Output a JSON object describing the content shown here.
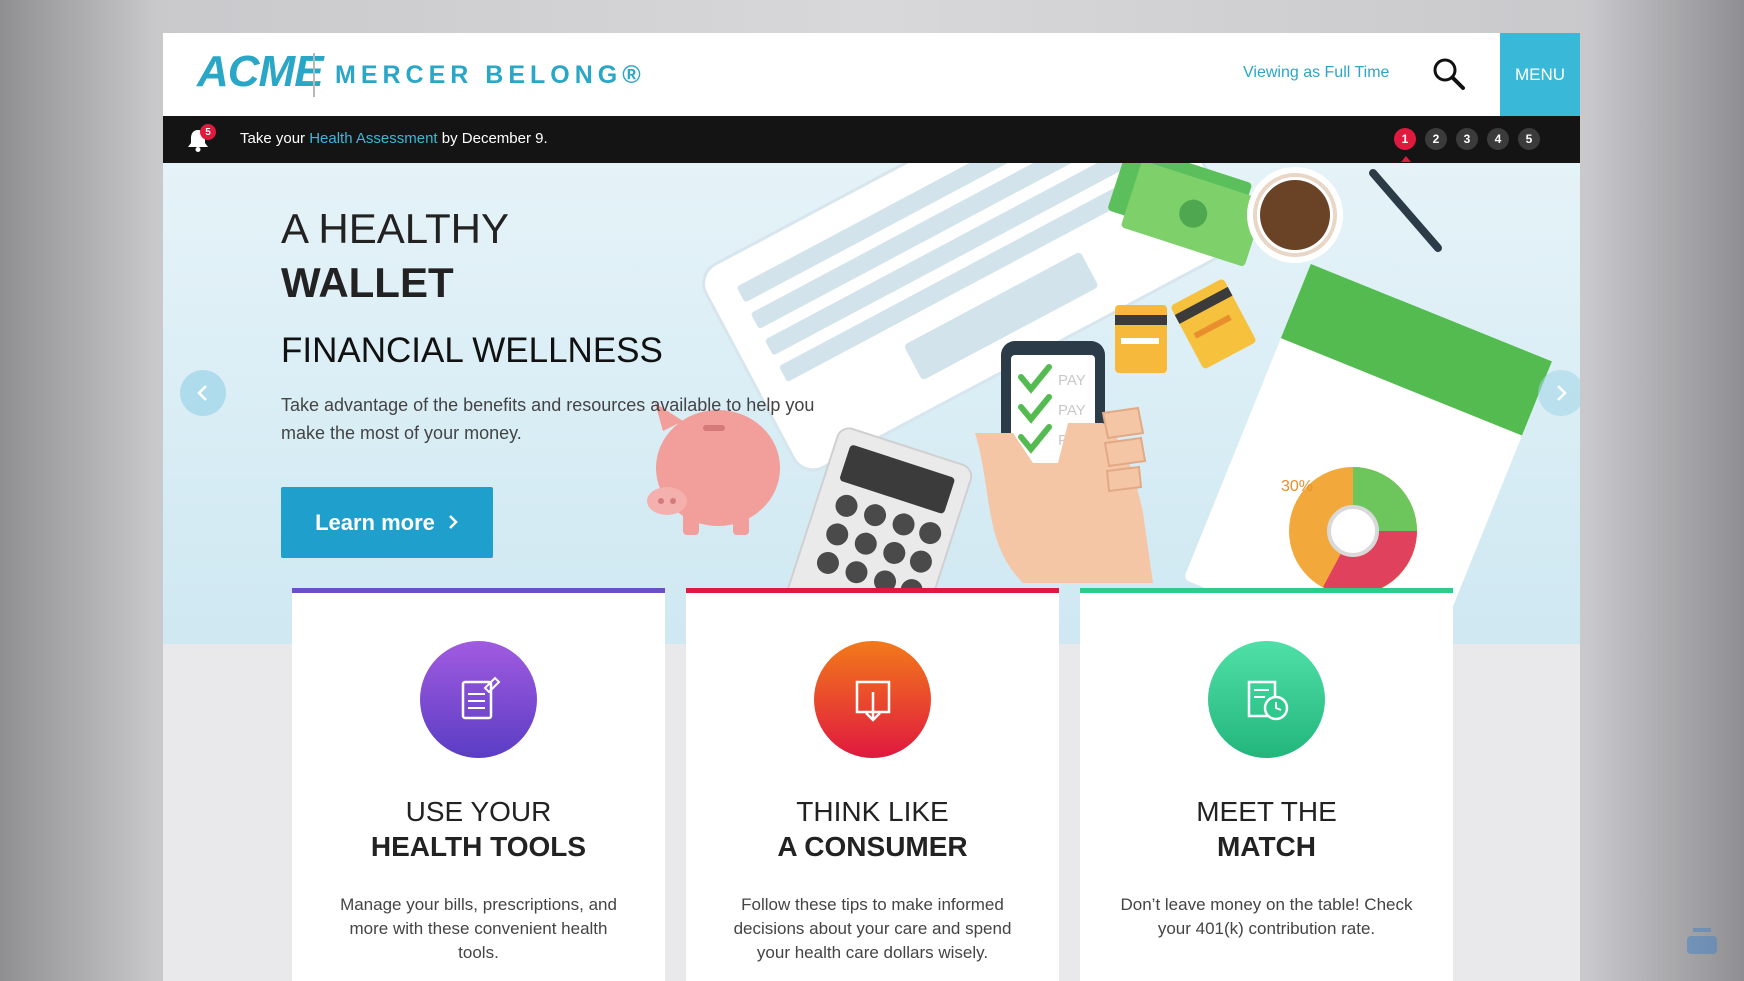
{
  "header": {
    "logo_brand": "ACME",
    "logo_product": "MERCER BELONG®",
    "viewing_label": "Viewing as Full Time",
    "menu_label": "MENU"
  },
  "notification": {
    "badge_count": "5",
    "text_before": "Take your ",
    "link_text": "Health Assessment",
    "text_after": " by December 9.",
    "pages": [
      "1",
      "2",
      "3",
      "4",
      "5"
    ],
    "active_page": "1"
  },
  "hero": {
    "title_light": "A HEALTHY",
    "title_bold": "WALLET",
    "subtitle": "FINANCIAL WELLNESS",
    "description": "Take advantage of the benefits and resources available to help you make the most of your money.",
    "button_label": "Learn more",
    "phone_items": [
      "PAY",
      "PAY",
      "PAY"
    ],
    "chart_label": "30%",
    "slide_count": 3
  },
  "cards": [
    {
      "title_light": "USE YOUR",
      "title_bold": "HEALTH TOOLS",
      "description": "Manage your bills, prescriptions, and more with these convenient health tools.",
      "accent": "#6b4fc9",
      "icon": "document-edit-icon"
    },
    {
      "title_light": "THINK LIKE",
      "title_bold": "A CONSUMER",
      "description": "Follow these tips to make informed decisions about your care and spend your health care dollars wisely.",
      "accent": "#e0193f",
      "icon": "download-tray-icon"
    },
    {
      "title_light": "MEET THE",
      "title_bold": "MATCH",
      "description": "Don’t leave money on the table! Check your 401(k) contribution rate.",
      "accent": "#2ecc8a",
      "icon": "clock-list-icon"
    }
  ],
  "colors": {
    "brand": "#2aa7c6",
    "menu_bg": "#3ab8d8",
    "notification_bg": "#141414",
    "alert_red": "#e0193f",
    "button_blue": "#1f9fcc"
  }
}
